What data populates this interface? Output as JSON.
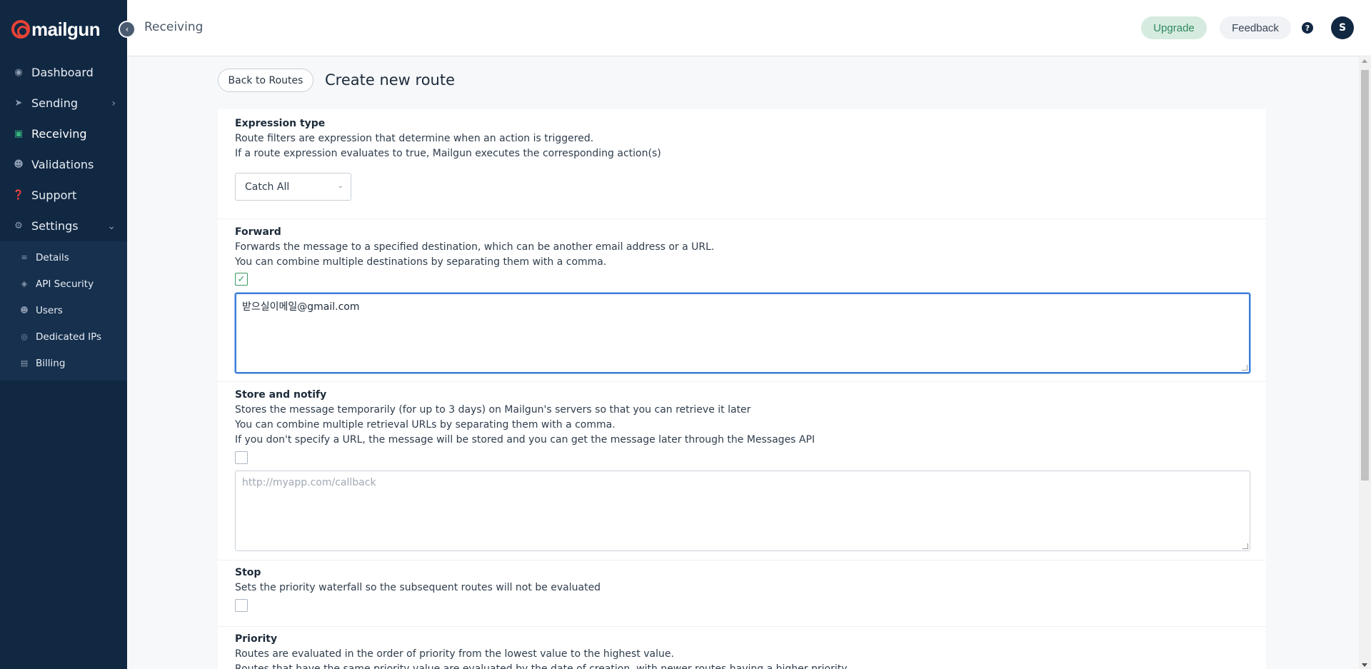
{
  "brand": {
    "logo_text": "mailgun"
  },
  "topbar": {
    "title": "Receiving",
    "upgrade_label": "Upgrade",
    "feedback_label": "Feedback",
    "help_glyph": "?",
    "avatar_initial": "S"
  },
  "sidebar": {
    "items": [
      {
        "label": "Dashboard",
        "icon": "dashboard-icon"
      },
      {
        "label": "Sending",
        "icon": "paper-plane-icon"
      },
      {
        "label": "Receiving",
        "icon": "inbox-icon"
      },
      {
        "label": "Validations",
        "icon": "user-check-icon"
      },
      {
        "label": "Support",
        "icon": "help-circle-icon"
      },
      {
        "label": "Settings",
        "icon": "gear-icon"
      }
    ],
    "settings_sub": [
      {
        "label": "Details",
        "icon": "sliders-icon"
      },
      {
        "label": "API Security",
        "icon": "shield-icon"
      },
      {
        "label": "Users",
        "icon": "users-icon"
      },
      {
        "label": "Dedicated IPs",
        "icon": "location-icon"
      },
      {
        "label": "Billing",
        "icon": "card-icon"
      }
    ]
  },
  "page": {
    "back_label": "Back to Routes",
    "title": "Create new route"
  },
  "expression": {
    "title": "Expression type",
    "line1": "Route filters are expression that determine when an action is triggered.",
    "line2": "If a route expression evaluates to true, Mailgun executes the corresponding action(s)",
    "selected": "Catch All"
  },
  "forward": {
    "title": "Forward",
    "line1": "Forwards the message to a specified destination, which can be another email address or a URL.",
    "line2": "You can combine multiple destinations by separating them with a comma.",
    "checked": true,
    "value": "받으실이메일@gmail.com"
  },
  "store": {
    "title": "Store and notify",
    "line1": "Stores the message temporarily (for up to 3 days) on Mailgun's servers so that you can retrieve it later",
    "line2": "You can combine multiple retrieval URLs by separating them with a comma.",
    "line3": "If you don't specify a URL, the message will be stored and you can get the message later through the Messages API",
    "checked": false,
    "placeholder": "http://myapp.com/callback"
  },
  "stop": {
    "title": "Stop",
    "line1": "Sets the priority waterfall so the subsequent routes will not be evaluated",
    "checked": false
  },
  "priority": {
    "title": "Priority",
    "line1": "Routes are evaluated in the order of priority from the lowest value to the highest value.",
    "line2": "Routes that have the same priority value are evaluated by the date of creation, with newer routes having a higher priority."
  },
  "colors": {
    "sidebar_bg": "#112843",
    "accent_green": "#36b37e",
    "logo_red": "#e84336",
    "focus_blue": "#3b7dd8"
  }
}
